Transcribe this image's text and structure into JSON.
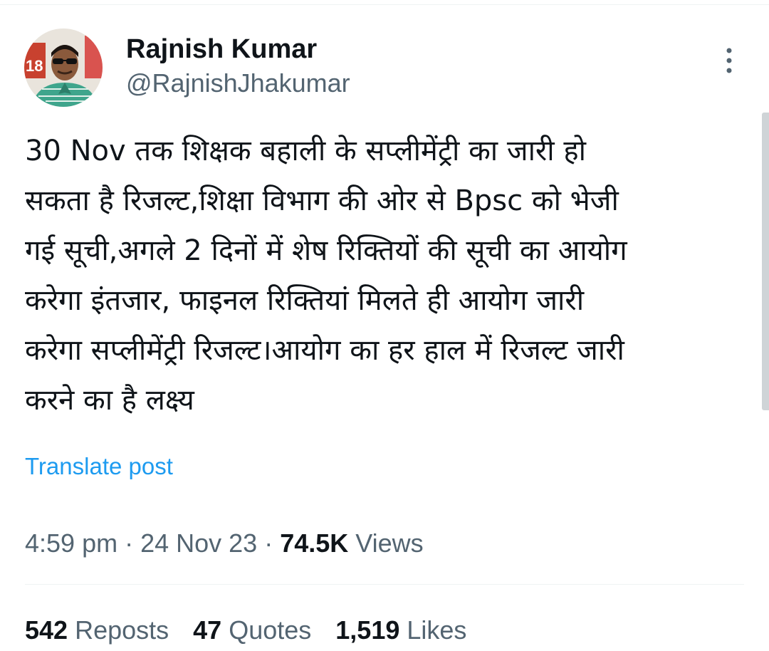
{
  "tweet": {
    "author": {
      "display_name": "Rajnish Kumar",
      "handle": "@RajnishJhakumar",
      "avatar_badge_text": "18"
    },
    "text": "30 Nov तक शिक्षक बहाली के सप्लीमेंट्री का जारी हो\nसकता है रिजल्ट,शिक्षा विभाग की ओर से  Bpsc को भेजी\nगई सूची,अगले 2 दिनों में शेष रिक्तियों की सूची का आयोग\nकरेगा इंतजार, फाइनल रिक्तियां मिलते ही आयोग जारी\nकरेगा सप्लीमेंट्री रिजल्ट।आयोग का हर हाल में रिजल्ट जारी\nकरने का है लक्ष्य",
    "translate_label": "Translate post",
    "time": "4:59 pm",
    "separator": " · ",
    "date": "24 Nov 23",
    "views_count": "74.5K",
    "views_label": " Views",
    "stats": {
      "reposts_count": "542",
      "reposts_label": " Reposts",
      "quotes_count": "47",
      "quotes_label": " Quotes",
      "likes_count": "1,519",
      "likes_label": " Likes"
    }
  },
  "icons": {
    "more": "more-vertical-icon"
  },
  "colors": {
    "link": "#1d9bf0",
    "secondary_text": "#536471",
    "primary_text": "#0f1419",
    "divider": "#eff3f4"
  }
}
